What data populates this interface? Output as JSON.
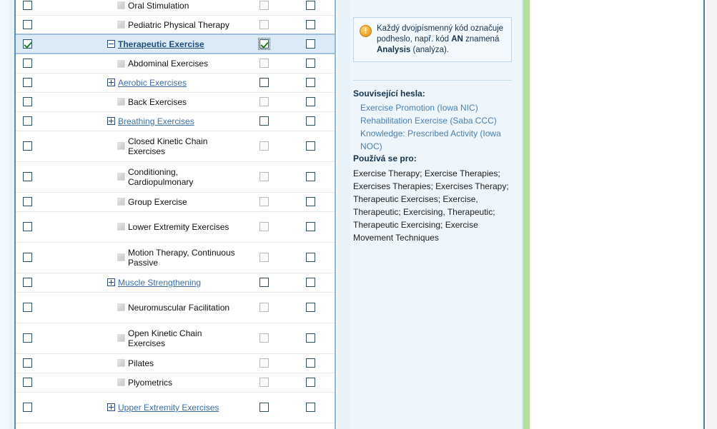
{
  "tree": {
    "rows": [
      {
        "label": "Oral Stimulation",
        "icon": "leaf-node-icon",
        "type": "leaf",
        "link": false,
        "col1": "unchecked",
        "col2": "disabled-unchecked",
        "col3": "unchecked",
        "selected": false,
        "two_line": false
      },
      {
        "label": "Pediatric Physical Therapy",
        "icon": "leaf-node-icon",
        "type": "leaf",
        "link": false,
        "col1": "unchecked",
        "col2": "disabled-unchecked",
        "col3": "unchecked",
        "selected": false,
        "two_line": false
      },
      {
        "label": "Therapeutic Exercise",
        "icon": "minus-expander-icon",
        "type": "expanded",
        "link": true,
        "bold": true,
        "col1": "checked",
        "col2": "checked-focused",
        "col3": "unchecked",
        "selected": true,
        "two_line": false
      },
      {
        "label": "Abdominal Exercises",
        "icon": "leaf-node-icon",
        "type": "leaf",
        "link": false,
        "col1": "unchecked",
        "col2": "disabled-unchecked",
        "col3": "unchecked",
        "selected": false,
        "two_line": false
      },
      {
        "label": "Aerobic Exercises",
        "icon": "plus-expander-icon",
        "type": "collapsed",
        "link": true,
        "col1": "unchecked",
        "col2": "unchecked",
        "col3": "unchecked",
        "selected": false,
        "two_line": false
      },
      {
        "label": "Back Exercises",
        "icon": "leaf-node-icon",
        "type": "leaf",
        "link": false,
        "col1": "unchecked",
        "col2": "disabled-unchecked",
        "col3": "unchecked",
        "selected": false,
        "two_line": false
      },
      {
        "label": "Breathing Exercises",
        "icon": "plus-expander-icon",
        "type": "collapsed",
        "link": true,
        "col1": "unchecked",
        "col2": "unchecked",
        "col3": "unchecked",
        "selected": false,
        "two_line": false
      },
      {
        "label": "Closed Kinetic Chain Exercises",
        "icon": "leaf-node-icon",
        "type": "leaf",
        "link": false,
        "col1": "unchecked",
        "col2": "disabled-unchecked",
        "col3": "unchecked",
        "selected": false,
        "two_line": true
      },
      {
        "label": "Conditioning, Cardiopulmonary",
        "icon": "leaf-node-icon",
        "type": "leaf",
        "link": false,
        "col1": "unchecked",
        "col2": "disabled-unchecked",
        "col3": "unchecked",
        "selected": false,
        "two_line": true
      },
      {
        "label": "Group Exercise",
        "icon": "leaf-node-icon",
        "type": "leaf",
        "link": false,
        "col1": "unchecked",
        "col2": "disabled-unchecked",
        "col3": "unchecked",
        "selected": false,
        "two_line": false
      },
      {
        "label": "Lower Extremity Exercises",
        "icon": "leaf-node-icon",
        "type": "leaf",
        "link": false,
        "col1": "unchecked",
        "col2": "disabled-unchecked",
        "col3": "unchecked",
        "selected": false,
        "two_line": true
      },
      {
        "label": "Motion Therapy, Continuous Passive",
        "icon": "leaf-node-icon",
        "type": "leaf",
        "link": false,
        "col1": "unchecked",
        "col2": "disabled-unchecked",
        "col3": "unchecked",
        "selected": false,
        "two_line": true
      },
      {
        "label": "Muscle Strengthening",
        "icon": "plus-expander-icon",
        "type": "collapsed",
        "link": true,
        "col1": "unchecked",
        "col2": "unchecked",
        "col3": "unchecked",
        "selected": false,
        "two_line": false
      },
      {
        "label": "Neuromuscular Facilitation",
        "icon": "leaf-node-icon",
        "type": "leaf",
        "link": false,
        "col1": "unchecked",
        "col2": "disabled-unchecked",
        "col3": "unchecked",
        "selected": false,
        "two_line": true
      },
      {
        "label": "Open Kinetic Chain Exercises",
        "icon": "leaf-node-icon",
        "type": "leaf",
        "link": false,
        "col1": "unchecked",
        "col2": "disabled-unchecked",
        "col3": "unchecked",
        "selected": false,
        "two_line": true
      },
      {
        "label": "Pilates",
        "icon": "leaf-node-icon",
        "type": "leaf",
        "link": false,
        "col1": "unchecked",
        "col2": "disabled-unchecked",
        "col3": "unchecked",
        "selected": false,
        "two_line": false
      },
      {
        "label": "Plyometrics",
        "icon": "leaf-node-icon",
        "type": "leaf",
        "link": false,
        "col1": "unchecked",
        "col2": "disabled-unchecked",
        "col3": "unchecked",
        "selected": false,
        "two_line": false
      },
      {
        "label": "Upper Extremity Exercises",
        "icon": "plus-expander-icon",
        "type": "collapsed",
        "link": true,
        "col1": "unchecked",
        "col2": "unchecked",
        "col3": "unchecked",
        "selected": false,
        "two_line": true
      }
    ]
  },
  "details": {
    "info_box": {
      "icon": "warning-icon",
      "text_part1": "Každý dvojpísmenný kód označuje podheslo, např. kód ",
      "code_an": "AN",
      "text_part2": " znamená ",
      "code_analysis": "Analysis",
      "text_part3": " (analýza)."
    },
    "related_heading": "Související hesla:",
    "related_terms": [
      "Exercise Promotion (Iowa NIC)",
      "Rehabilitation Exercise (Saba CCC)",
      "Knowledge: Prescribed Activity (Iowa NOC)"
    ],
    "used_for_heading": "Používá se pro:",
    "used_for_text": "Exercise Therapy; Exercise Therapies; Exercises Therapies; Exercises Therapy; Therapeutic Exercises; Exercise, Therapeutic; Exercising, Therapeutic; Therapeutic Exercising; Exercise Movement Techniques"
  },
  "colors": {
    "selected_row_bg": "#dceaf7",
    "link": "#3c6fa5",
    "heading": "#14334d",
    "green_bar": "#b5dc9b",
    "panel_bg": "#eef6fc",
    "check_green": "#1d7a27",
    "warn_orange": "#f0a930"
  }
}
